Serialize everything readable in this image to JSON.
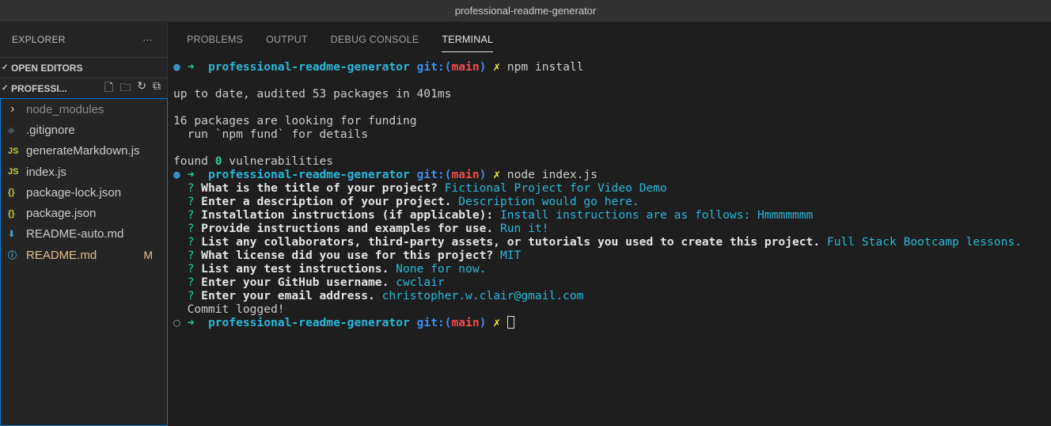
{
  "window": {
    "title": "professional-readme-generator"
  },
  "sidebar": {
    "title": "EXPLORER",
    "more": "···",
    "open_editors": "OPEN EDITORS",
    "folder": "PROFESSI...",
    "items": [
      {
        "label": "node_modules",
        "icon": "›",
        "icon_name": "chevron-right-icon",
        "color": "#8b8b8b",
        "icon_color": "#ccc"
      },
      {
        "label": ".gitignore",
        "icon": "◆",
        "icon_name": "git-icon",
        "color": "#ccc",
        "icon_color": "#41535b"
      },
      {
        "label": "generateMarkdown.js",
        "icon": "JS",
        "icon_name": "javascript-icon",
        "color": "#ccc",
        "icon_color": "#cbcb41"
      },
      {
        "label": "index.js",
        "icon": "JS",
        "icon_name": "javascript-icon",
        "color": "#ccc",
        "icon_color": "#cbcb41"
      },
      {
        "label": "package-lock.json",
        "icon": "{}",
        "icon_name": "json-icon",
        "color": "#ccc",
        "icon_color": "#cbcb41"
      },
      {
        "label": "package.json",
        "icon": "{}",
        "icon_name": "json-icon",
        "color": "#ccc",
        "icon_color": "#cbcb41"
      },
      {
        "label": "README-auto.md",
        "icon": "⬇",
        "icon_name": "markdown-icon",
        "color": "#ccc",
        "icon_color": "#519aba"
      },
      {
        "label": "README.md",
        "icon": "ⓘ",
        "icon_name": "info-icon",
        "color": "#e2c08d",
        "icon_color": "#519aba",
        "badge": "M"
      }
    ]
  },
  "panel": {
    "tabs": [
      "PROBLEMS",
      "OUTPUT",
      "DEBUG CONSOLE",
      "TERMINAL"
    ],
    "active_tab": 3
  },
  "terminal": {
    "lines": [
      [
        [
          "● ",
          "dot"
        ],
        [
          "➜  ",
          "arrow"
        ],
        [
          "professional-readme-generator ",
          "dir"
        ],
        [
          "git:(",
          "git"
        ],
        [
          "main",
          "branch"
        ],
        [
          ") ",
          "git"
        ],
        [
          "✗ ",
          "x"
        ],
        [
          "npm install",
          ""
        ]
      ],
      [],
      [
        [
          "up to date, audited 53 packages in 401ms",
          ""
        ]
      ],
      [],
      [
        [
          "16 packages are looking for funding",
          ""
        ]
      ],
      [
        [
          "  run `npm fund` for details",
          ""
        ]
      ],
      [],
      [
        [
          "found ",
          ""
        ],
        [
          "0",
          "zero"
        ],
        [
          " vulnerabilities",
          ""
        ]
      ],
      [
        [
          "● ",
          "dot"
        ],
        [
          "➜  ",
          "arrow"
        ],
        [
          "professional-readme-generator ",
          "dir"
        ],
        [
          "git:(",
          "git"
        ],
        [
          "main",
          "branch"
        ],
        [
          ") ",
          "git"
        ],
        [
          "✗ ",
          "x"
        ],
        [
          "node index.js",
          ""
        ]
      ],
      [
        [
          "  ? ",
          "q"
        ],
        [
          "What is the title of your project? ",
          "b"
        ],
        [
          "Fictional Project for Video Demo",
          "ans"
        ]
      ],
      [
        [
          "  ? ",
          "q"
        ],
        [
          "Enter a description of your project. ",
          "b"
        ],
        [
          "Description would go here.",
          "ans"
        ]
      ],
      [
        [
          "  ? ",
          "q"
        ],
        [
          "Installation instructions (if applicable): ",
          "b"
        ],
        [
          "Install instructions are as follows: Hmmmmmmm",
          "ans"
        ]
      ],
      [
        [
          "  ? ",
          "q"
        ],
        [
          "Provide instructions and examples for use. ",
          "b"
        ],
        [
          "Run it!",
          "ans"
        ]
      ],
      [
        [
          "  ? ",
          "q"
        ],
        [
          "List any collaborators, third-party assets, or tutorials you used to create this project. ",
          "b"
        ],
        [
          "Full Stack Bootcamp lessons.",
          "ans"
        ]
      ],
      [
        [
          "  ? ",
          "q"
        ],
        [
          "What license did you use for this project? ",
          "b"
        ],
        [
          "MIT",
          "ans"
        ]
      ],
      [
        [
          "  ? ",
          "q"
        ],
        [
          "List any test instructions. ",
          "b"
        ],
        [
          "None for now.",
          "ans"
        ]
      ],
      [
        [
          "  ? ",
          "q"
        ],
        [
          "Enter your GitHub username. ",
          "b"
        ],
        [
          "cwclair",
          "ans"
        ]
      ],
      [
        [
          "  ? ",
          "q"
        ],
        [
          "Enter your email address. ",
          "b"
        ],
        [
          "christopher.w.clair@gmail.com",
          "ans"
        ]
      ],
      [
        [
          "  Commit logged!",
          ""
        ]
      ],
      [
        [
          "○ ",
          "dotempty"
        ],
        [
          "➜  ",
          "arrow"
        ],
        [
          "professional-readme-generator ",
          "dir"
        ],
        [
          "git:(",
          "git"
        ],
        [
          "main",
          "branch"
        ],
        [
          ") ",
          "git"
        ],
        [
          "✗ ",
          "x"
        ]
      ]
    ]
  }
}
